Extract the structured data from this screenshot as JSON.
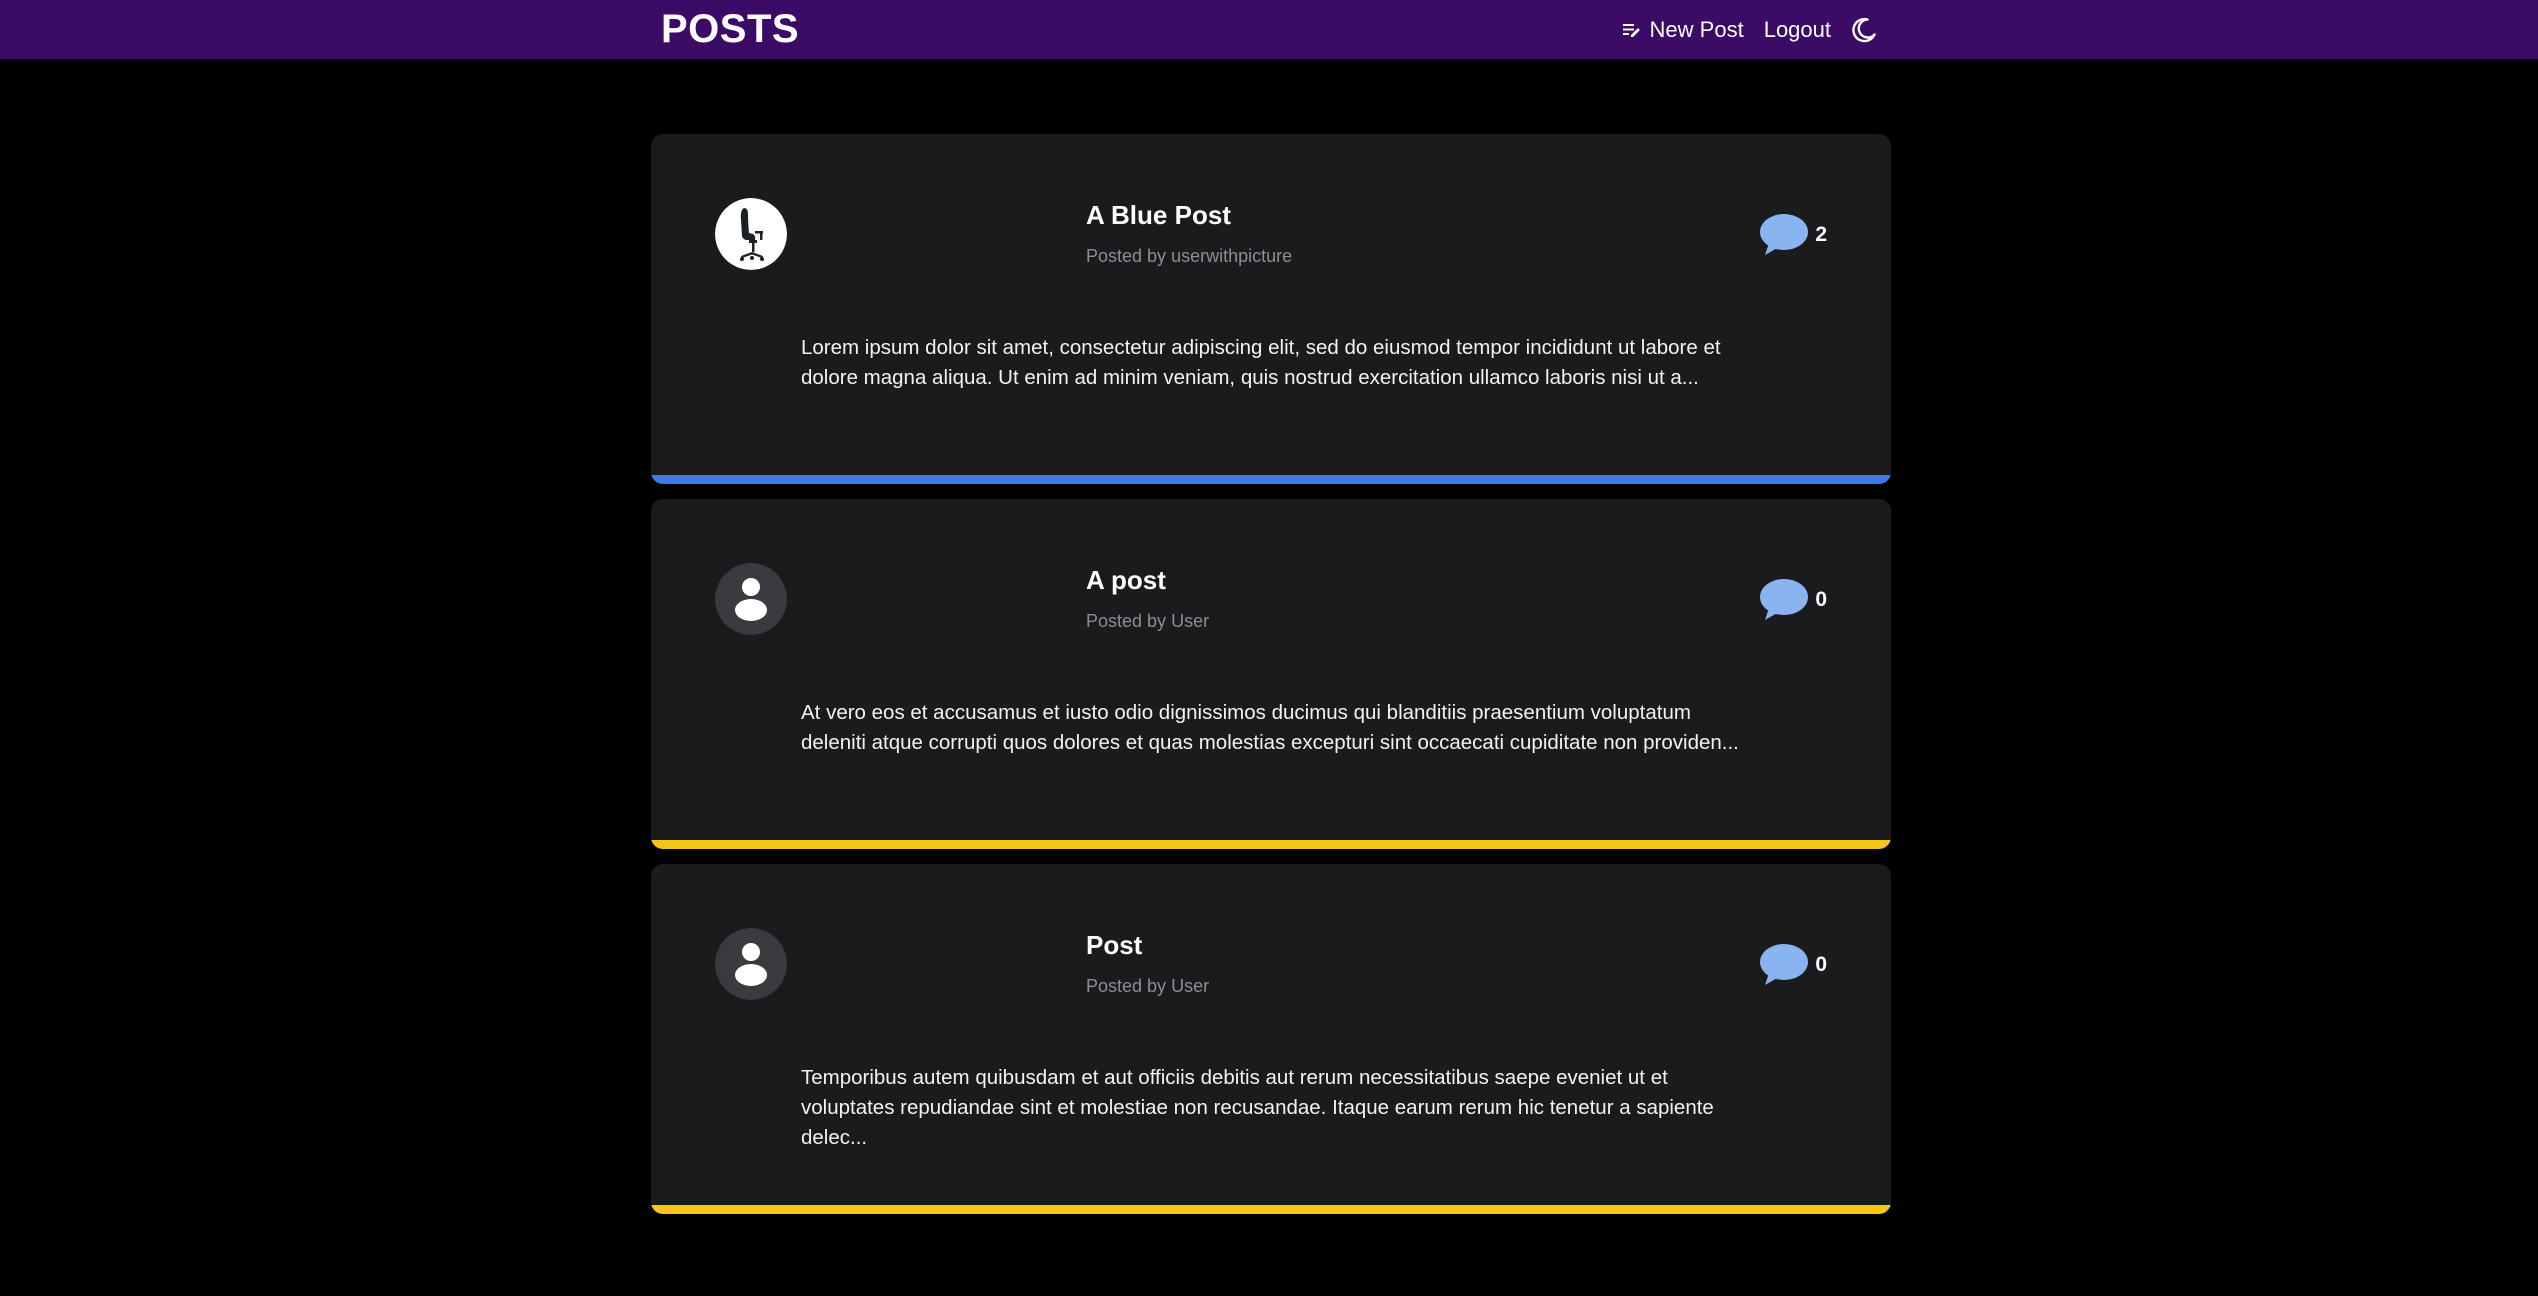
{
  "header": {
    "brand": "POSTS",
    "new_post_label": "New Post",
    "logout_label": "Logout",
    "icons": {
      "new_post": "edit-note-icon",
      "theme": "moon-icon"
    },
    "background": "#3b0b66"
  },
  "posts": [
    {
      "title": "A Blue Post",
      "posted_by_prefix": "Posted by",
      "author": "userwithpicture",
      "comment_count": "2",
      "excerpt": "Lorem ipsum dolor sit amet, consectetur adipiscing elit, sed do eiusmod tempor incididunt ut labore et dolore magna aliqua. Ut enim ad minim veniam, quis nostrud exercitation ullamco laboris nisi ut a...",
      "accent_color": "#3b7be8",
      "avatar": "office-chair-photo"
    },
    {
      "title": "A post",
      "posted_by_prefix": "Posted by",
      "author": "User",
      "comment_count": "0",
      "excerpt": "At vero eos et accusamus et iusto odio dignissimos ducimus qui blanditiis praesentium voluptatum deleniti atque corrupti quos dolores et quas molestias excepturi sint occaecati cupiditate non providen...",
      "accent_color": "#f5c518",
      "avatar": "default-user-icon"
    },
    {
      "title": "Post",
      "posted_by_prefix": "Posted by",
      "author": "User",
      "comment_count": "0",
      "excerpt": "Temporibus autem quibusdam et aut officiis debitis aut rerum necessitatibus saepe eveniet ut et voluptates repudiandae sint et molestiae non recusandae. Itaque earum rerum hic tenetur a sapiente delec...",
      "accent_color": "#f5c518",
      "avatar": "default-user-icon"
    }
  ],
  "colors": {
    "page_background": "#000000",
    "card_background": "#1b1b1e",
    "comment_bubble": "#8ab4f0",
    "meta_text": "#8d8d93"
  }
}
